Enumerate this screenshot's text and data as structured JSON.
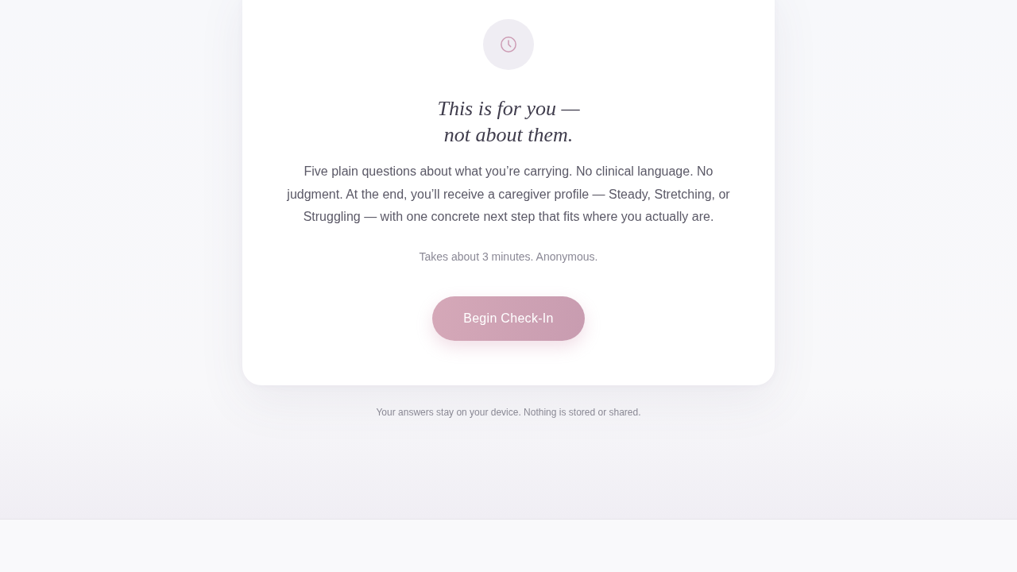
{
  "card": {
    "title_lines": [
      "This is for you —",
      "not about them."
    ],
    "description": "Five plain questions about what you’re carrying. No clinical language. No judgment. At the end, you’ll receive a caregiver profile — Steady, Stretching, or Struggling — with one concrete next step that fits where you actually are.",
    "note": "Takes about 3 minutes. Anonymous.",
    "button": "Begin Check-In"
  },
  "footer_note": "Your answers stay on your device. Nothing is stored or shared."
}
